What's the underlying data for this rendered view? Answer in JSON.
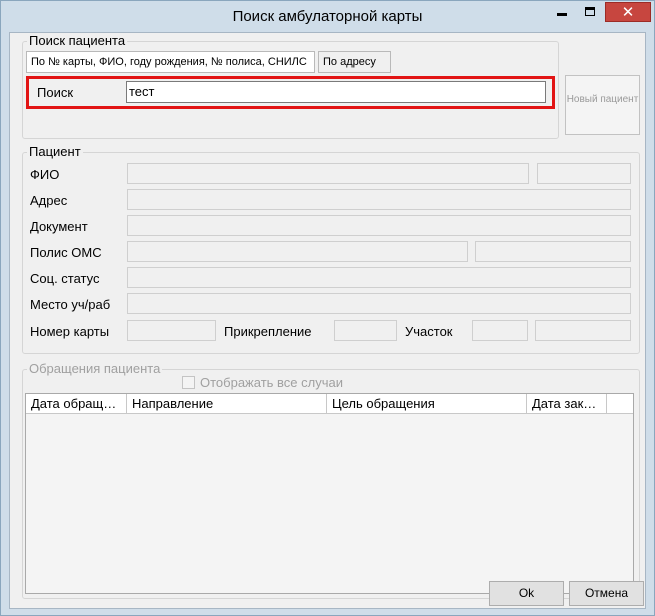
{
  "window": {
    "title": "Поиск амбулаторной карты",
    "controls": [
      "minimize-icon",
      "maximize-icon",
      "close-icon"
    ]
  },
  "search_group": {
    "label": "Поиск пациента",
    "tabs": [
      "По № карты, ФИО, году рождения, № полиса, СНИЛС",
      "По адресу"
    ],
    "search_label": "Поиск",
    "search_value": "тест",
    "new_patient_label": "Новый пациент"
  },
  "patient_group": {
    "label": "Пациент",
    "fio_label": "ФИО",
    "address_label": "Адрес",
    "document_label": "Документ",
    "policy_label": "Полис ОМС",
    "social_status_label": "Соц. статус",
    "workplace_label": "Место уч/раб",
    "card_number_label": "Номер карты",
    "attachment_label": "Прикрепление",
    "district_label": "Участок"
  },
  "visits_group": {
    "label": "Обращения пациента",
    "show_all_label": "Отображать все случаи",
    "show_all_checked": false,
    "columns": [
      "Дата обращ…",
      "Направление",
      "Цель обращения",
      "Дата зак…"
    ]
  },
  "footer": {
    "ok_label": "Ok",
    "cancel_label": "Отмена"
  },
  "colors": {
    "focus_highlight": "#e21414",
    "close_button": "#c7463f",
    "window_frame": "#cfdde9"
  }
}
